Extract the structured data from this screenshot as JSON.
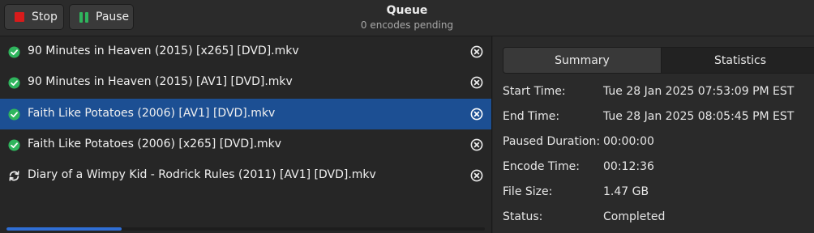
{
  "header": {
    "stop_label": "Stop",
    "pause_label": "Pause",
    "title": "Queue",
    "subtitle": "0 encodes pending"
  },
  "queue": {
    "items": [
      {
        "name": "90 Minutes in Heaven (2015) [x265] [DVD].mkv",
        "status": "completed",
        "icon": "check-circle-icon"
      },
      {
        "name": "90 Minutes in Heaven (2015) [AV1] [DVD].mkv",
        "status": "completed",
        "icon": "check-circle-icon"
      },
      {
        "name": "Faith Like Potatoes (2006) [AV1] [DVD].mkv",
        "status": "completed",
        "icon": "check-circle-icon",
        "selected": true
      },
      {
        "name": "Faith Like Potatoes (2006) [x265] [DVD].mkv",
        "status": "completed",
        "icon": "check-circle-icon"
      },
      {
        "name": "Diary of a Wimpy Kid - Rodrick Rules (2011) [AV1] [DVD].mkv",
        "status": "encoding",
        "icon": "refresh-icon",
        "progress": 0.24
      }
    ]
  },
  "tabs": {
    "summary": "Summary",
    "statistics": "Statistics"
  },
  "summary": {
    "start_time_label": "Start Time:",
    "start_time": "Tue 28 Jan 2025 07:53:09 PM EST",
    "end_time_label": "End Time:",
    "end_time": "Tue 28 Jan 2025 08:05:45 PM EST",
    "paused_label": "Paused Duration:",
    "paused": "00:00:00",
    "encode_time_label": "Encode Time:",
    "encode_time": "00:12:36",
    "file_size_label": "File Size:",
    "file_size": "1.47 GB",
    "status_label": "Status:",
    "status": "Completed"
  },
  "colors": {
    "accent": "#1c4f93",
    "success": "#2fb55d",
    "stop": "#d81b1b",
    "progress": "#2f6ed5"
  }
}
